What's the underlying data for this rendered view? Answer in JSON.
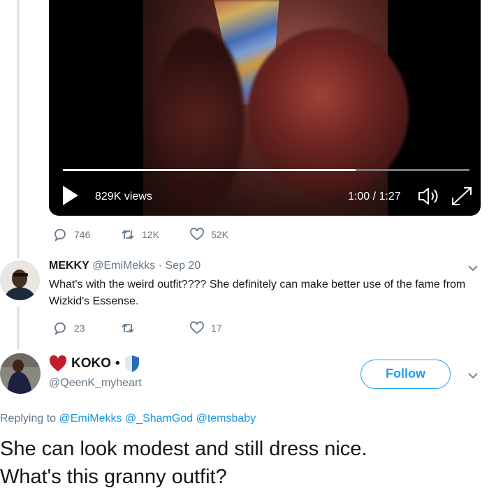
{
  "video": {
    "views": "829K views",
    "time": "1:00 / 1:27",
    "progress_fraction": 0.72
  },
  "main_tweet_actions": {
    "replies": "746",
    "retweets": "12K",
    "likes": "52K"
  },
  "reply1": {
    "display_name": "MEKKY",
    "handle": "@EmiMekks",
    "date": "· Sep 20",
    "text": "What's with the weird outfit???? She definitely can make better use of the fame from Wizkid's Essense.",
    "replies": "23",
    "likes": "17"
  },
  "reply2": {
    "display_name": "KOKO",
    "name_dot": "•",
    "handle": "@QeenK_myheart",
    "follow_label": "Follow",
    "replying_prefix": "Replying to",
    "replying_to": "@EmiMekks @_ShamGod @temsbaby",
    "text_line1": "She can look modest and still dress nice.",
    "text_line2": "What's this granny outfit?"
  },
  "colors": {
    "accent": "#1da1f2",
    "link": "#1b95e0",
    "muted": "#657786",
    "heart_red": "#c0202a",
    "shield_blue": "#2a6db5"
  },
  "icons": [
    "play-icon",
    "volume-icon",
    "expand-icon",
    "reply-icon",
    "retweet-icon",
    "like-icon",
    "chevron-down-icon",
    "heart-emoji-icon",
    "shield-emoji-icon"
  ]
}
